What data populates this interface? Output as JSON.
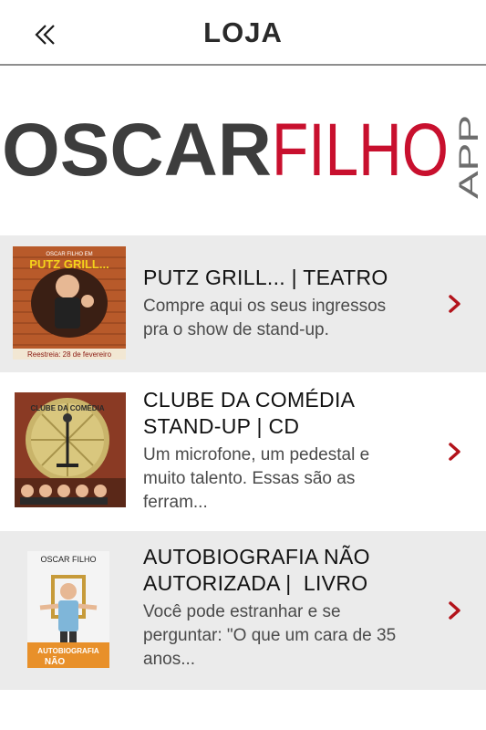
{
  "header": {
    "title": "LOJA",
    "back_icon": "double-chevron-left-icon"
  },
  "logo": {
    "part1": "OSCAR",
    "part2": "FILHO",
    "part3": "APP",
    "color_dark": "#3d3d3d",
    "color_red": "#c8102e",
    "color_app": "#6d6d6d"
  },
  "products": [
    {
      "title_lines": [
        "PUTZ GRILL... | TEATRO"
      ],
      "description_lines": [
        "Compre aqui os seus ingressos",
        "pra o show de stand-up."
      ],
      "thumb_text_top": "OSCAR FILHO EM",
      "thumb_text_main": "PUTZ GRILL...",
      "thumb_caption": "Reestreia: 28 de fevereiro"
    },
    {
      "title_lines": [
        "CLUBE DA COMÉDIA",
        "STAND-UP | CD"
      ],
      "description_lines": [
        "Um microfone, um pedestal e",
        "muito talento. Essas são as",
        "ferram..."
      ],
      "thumb_text_main": "CLUBE DA COMÉDIA"
    },
    {
      "title_lines": [
        "AUTOBIOGRAFIA NÃO",
        "AUTORIZADA |  LIVRO"
      ],
      "description_lines": [
        "Você pode estranhar e se",
        "perguntar: \"O que um cara de 35",
        "anos..."
      ],
      "thumb_text_top": "OSCAR FILHO",
      "thumb_text_bottom": "AUTOBIOGRAFIA",
      "thumb_text_bottom2": "NÃO"
    }
  ],
  "chevron_icon": "chevron-right-icon",
  "accent": "#b3131b"
}
